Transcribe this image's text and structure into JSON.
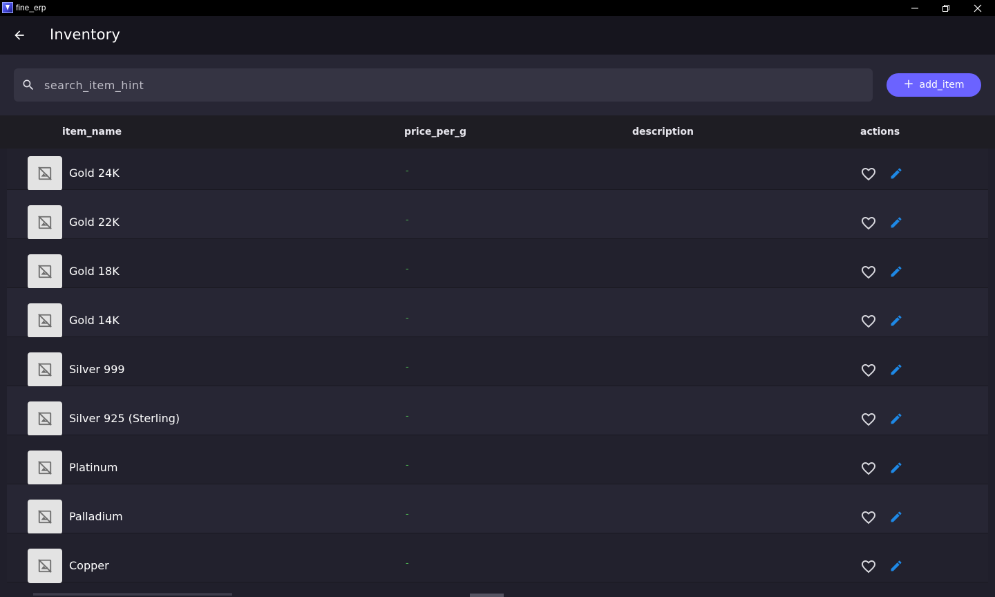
{
  "window": {
    "title": "fine_erp",
    "minimize_icon": "minimize-icon",
    "restore_icon": "restore-icon",
    "close_icon": "close-icon"
  },
  "appbar": {
    "back_icon": "arrow-back-icon",
    "title": "Inventory"
  },
  "toolbar": {
    "search_placeholder": "search_item_hint",
    "search_value": "",
    "add_label": "add_item",
    "add_icon": "plus-icon",
    "accent_color": "#6b63ff"
  },
  "table": {
    "columns": [
      "item_name",
      "price_per_g",
      "description",
      "actions"
    ],
    "rows": [
      {
        "name": "Gold 24K",
        "price": "-",
        "description": ""
      },
      {
        "name": "Gold 22K",
        "price": "-",
        "description": ""
      },
      {
        "name": "Gold 18K",
        "price": "-",
        "description": ""
      },
      {
        "name": "Gold 14K",
        "price": "-",
        "description": ""
      },
      {
        "name": "Silver 999",
        "price": "-",
        "description": ""
      },
      {
        "name": "Silver 925 (Sterling)",
        "price": "-",
        "description": ""
      },
      {
        "name": "Platinum",
        "price": "-",
        "description": ""
      },
      {
        "name": "Palladium",
        "price": "-",
        "description": ""
      },
      {
        "name": "Copper",
        "price": "-",
        "description": ""
      }
    ],
    "row_icons": {
      "thumbnail": "image-not-supported-icon",
      "favorite": "heart-outline-icon",
      "edit": "pencil-icon"
    },
    "edit_color": "#1e88e5",
    "price_color": "#4caf50"
  }
}
